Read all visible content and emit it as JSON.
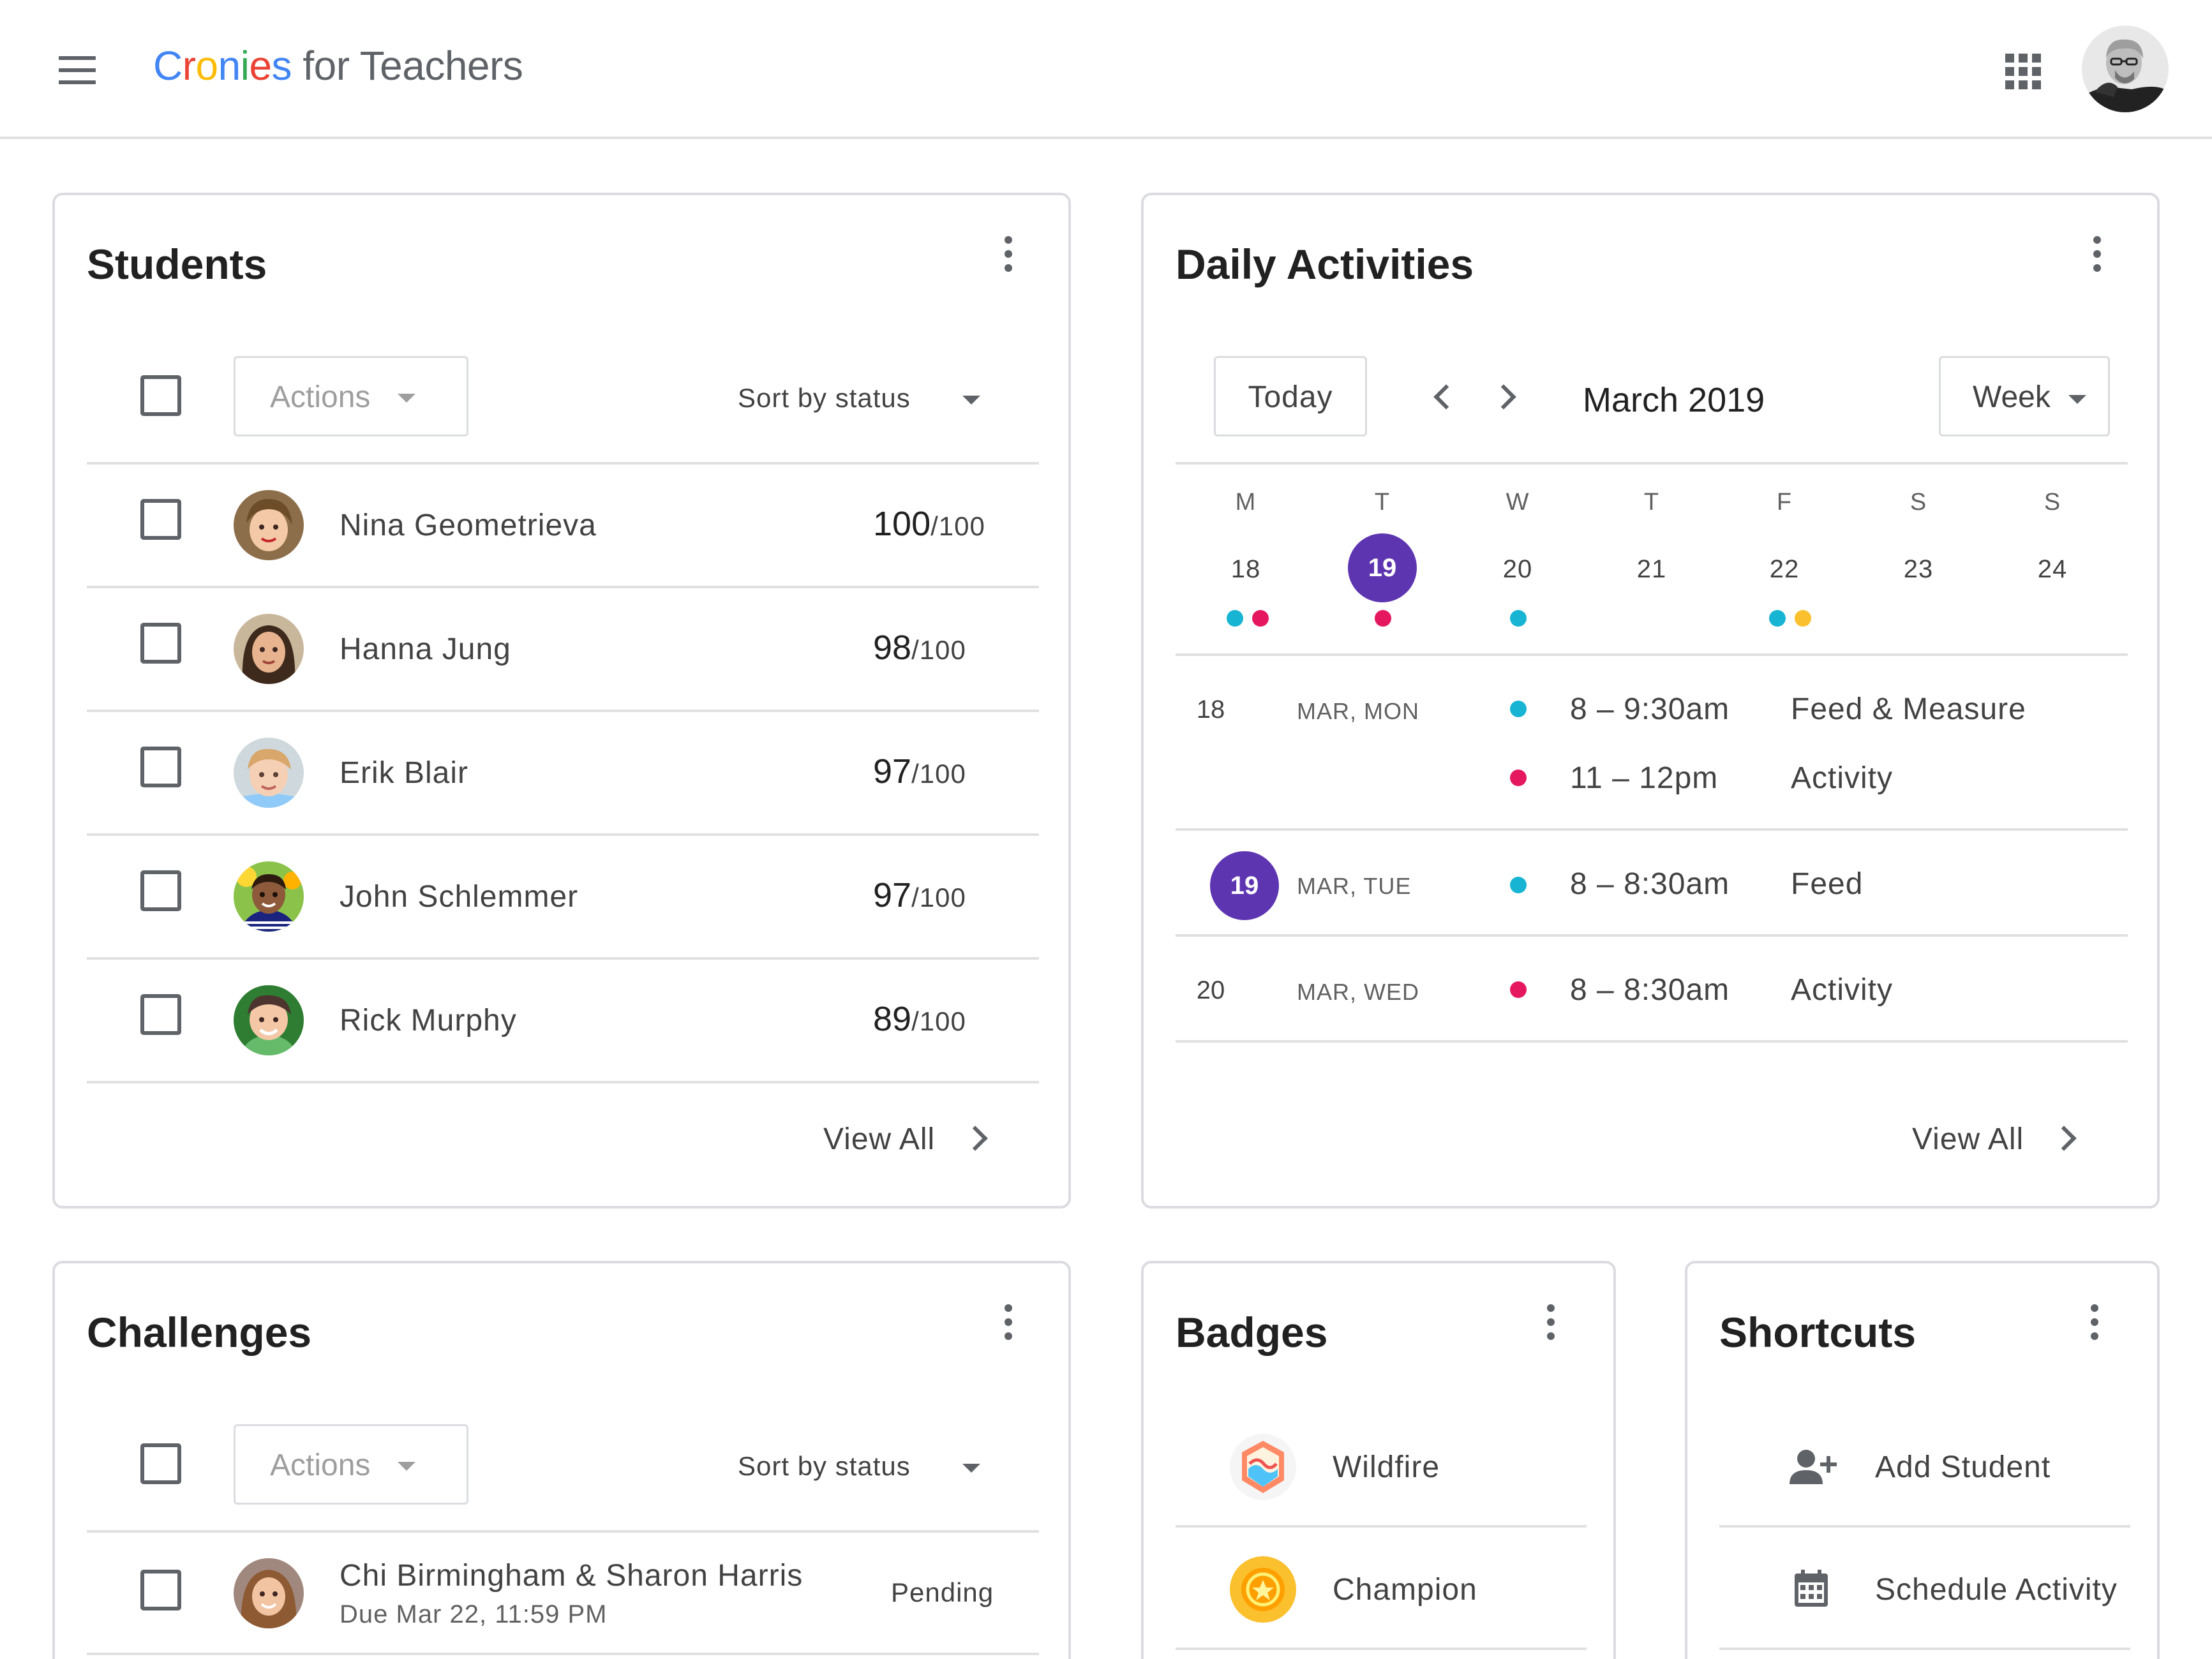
{
  "header": {
    "logo_letters": [
      "C",
      "r",
      "o",
      "n",
      "i",
      "e",
      "s"
    ],
    "logo_suffix": " for Teachers",
    "apps_icon": "apps-grid-icon",
    "avatar_icon": "user-avatar"
  },
  "colors": {
    "accent_purple": "#5e35b1",
    "dot_cyan": "#17b5d3",
    "dot_pink": "#e5175f",
    "dot_yellow": "#fbc02d"
  },
  "students": {
    "title": "Students",
    "actions_label": "Actions",
    "sort_label": "Sort by status",
    "rows": [
      {
        "name": "Nina Geometrieva",
        "score": "100",
        "total": "/100"
      },
      {
        "name": "Hanna Jung",
        "score": "98",
        "total": "/100"
      },
      {
        "name": "Erik Blair",
        "score": "97",
        "total": "/100"
      },
      {
        "name": "John Schlemmer",
        "score": "97",
        "total": "/100"
      },
      {
        "name": "Rick Murphy",
        "score": "89",
        "total": "/100"
      }
    ],
    "view_all": "View All"
  },
  "activities": {
    "title": "Daily Activities",
    "today_label": "Today",
    "month_label": "March 2019",
    "view_label": "Week",
    "weekdays": [
      "M",
      "T",
      "W",
      "T",
      "F",
      "S",
      "S"
    ],
    "days": [
      "18",
      "19",
      "20",
      "21",
      "22",
      "23",
      "24"
    ],
    "selected_day": "19",
    "events": [
      {
        "day": "18",
        "date": "MAR, MON",
        "time": "8 – 9:30am",
        "title": "Feed & Measure"
      },
      {
        "day": "",
        "date": "",
        "time": "11 – 12pm",
        "title": "Activity"
      },
      {
        "day": "19",
        "date": "MAR, TUE",
        "time": "8 – 8:30am",
        "title": "Feed"
      },
      {
        "day": "20",
        "date": "MAR, WED",
        "time": "8 – 8:30am",
        "title": "Activity"
      }
    ],
    "view_all": "View All"
  },
  "challenges": {
    "title": "Challenges",
    "actions_label": "Actions",
    "sort_label": "Sort by status",
    "rows": [
      {
        "name": "Chi Birmingham & Sharon Harris",
        "due": "Due Mar 22, 11:59 PM",
        "status": "Pending"
      }
    ]
  },
  "badges": {
    "title": "Badges",
    "items": [
      {
        "label": "Wildfire",
        "icon": "wildfire-badge-icon"
      },
      {
        "label": "Champion",
        "icon": "champion-badge-icon"
      }
    ]
  },
  "shortcuts": {
    "title": "Shortcuts",
    "items": [
      {
        "label": "Add Student",
        "icon": "add-person-icon"
      },
      {
        "label": "Schedule Activity",
        "icon": "calendar-icon"
      }
    ]
  }
}
